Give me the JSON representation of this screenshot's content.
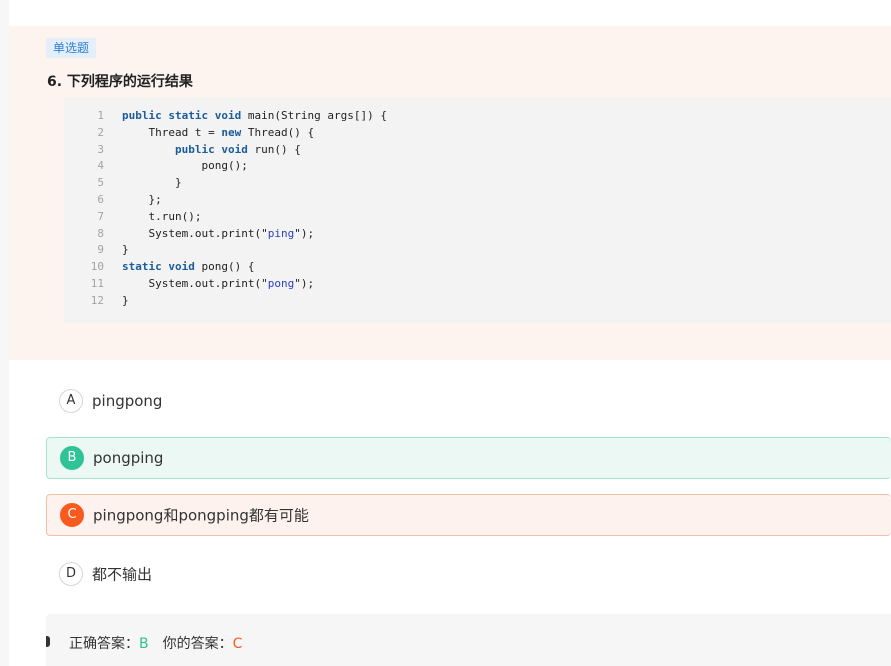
{
  "question": {
    "type_label": "单选题",
    "title": "6. 下列程序的运行结果"
  },
  "code": {
    "language": "java",
    "lines": [
      {
        "n": "1",
        "text": "public static void main(String args[]) {"
      },
      {
        "n": "2",
        "text": "    Thread t = new Thread() {"
      },
      {
        "n": "3",
        "text": "        public void run() {"
      },
      {
        "n": "4",
        "text": "            pong();"
      },
      {
        "n": "5",
        "text": "        }"
      },
      {
        "n": "6",
        "text": "    };"
      },
      {
        "n": "7",
        "text": "    t.run();"
      },
      {
        "n": "8",
        "text": "    System.out.print(\"ping\");"
      },
      {
        "n": "9",
        "text": "}"
      },
      {
        "n": "10",
        "text": "static void pong() {"
      },
      {
        "n": "11",
        "text": "    System.out.print(\"pong\");"
      },
      {
        "n": "12",
        "text": "}"
      }
    ]
  },
  "options": [
    {
      "letter": "A",
      "text": "pingpong",
      "state": "normal"
    },
    {
      "letter": "B",
      "text": "pongping",
      "state": "correct"
    },
    {
      "letter": "C",
      "text": "pingpong和pongping都有可能",
      "state": "wrong"
    },
    {
      "letter": "D",
      "text": "都不输出",
      "state": "normal"
    }
  ],
  "answer": {
    "correct_label": "正确答案：",
    "correct_value": "B",
    "user_label": "你的答案：",
    "user_value": "C"
  },
  "colors": {
    "correct": "#2fc395",
    "wrong": "#fa5a1e",
    "keyword": "#1b5c9a",
    "string": "#2a3fc5"
  }
}
